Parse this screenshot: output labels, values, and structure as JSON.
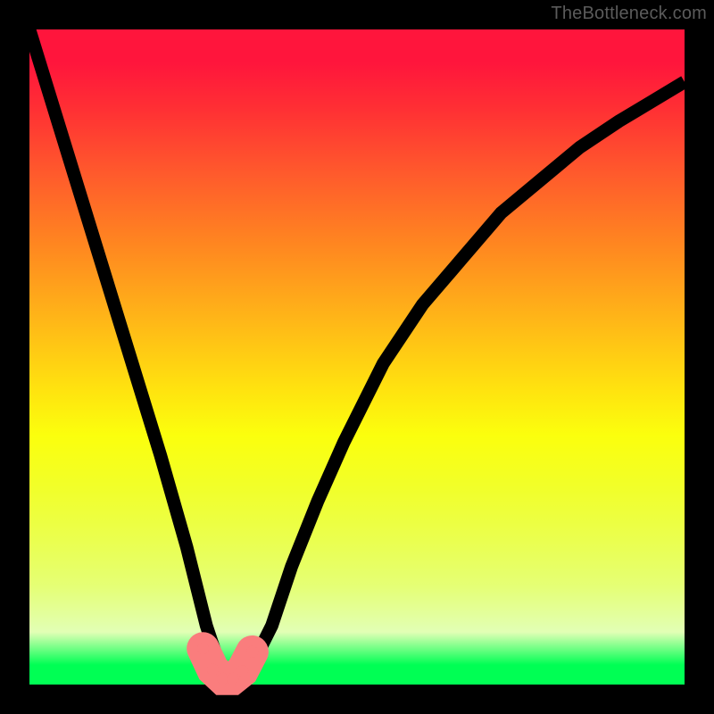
{
  "watermark": "TheBottleneck.com",
  "colors": {
    "frame_bg": "#000000",
    "curve": "#000000",
    "marker": "#fa7d7d",
    "gradient_top": "#ff153c",
    "gradient_bottom": "#00ff54"
  },
  "chart_data": {
    "type": "line",
    "title": "",
    "xlabel": "",
    "ylabel": "",
    "xlim": [
      0,
      100
    ],
    "ylim": [
      0,
      100
    ],
    "grid": false,
    "legend": false,
    "series": [
      {
        "name": "bottleneck-curve",
        "x": [
          0,
          4,
          8,
          12,
          16,
          20,
          24,
          27,
          29,
          30,
          32,
          34,
          37,
          40,
          44,
          48,
          54,
          60,
          66,
          72,
          78,
          84,
          90,
          95,
          100
        ],
        "values": [
          100,
          87,
          74,
          61,
          48,
          35,
          21,
          9,
          3,
          1,
          1,
          3,
          9,
          18,
          28,
          37,
          49,
          58,
          65,
          72,
          77,
          82,
          86,
          89,
          92
        ]
      }
    ],
    "markers": {
      "name": "optimal-region",
      "x": [
        26.5,
        28,
        29.5,
        31,
        32.5,
        34
      ],
      "values": [
        5.5,
        2.3,
        0.9,
        0.9,
        2.1,
        5.0
      ]
    }
  }
}
